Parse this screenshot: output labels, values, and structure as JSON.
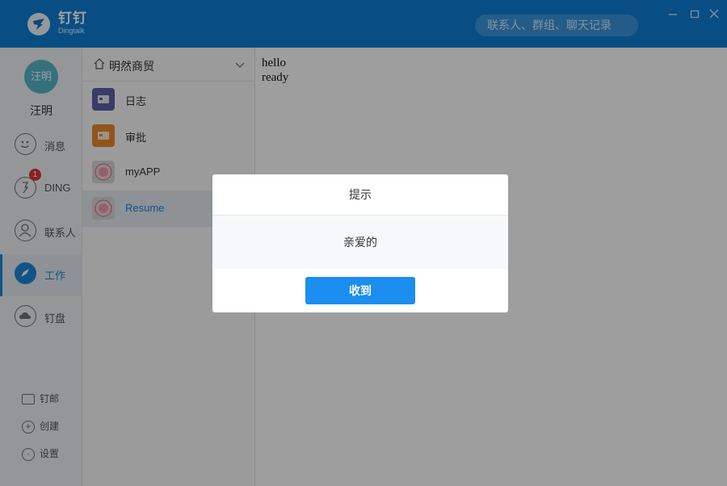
{
  "header": {
    "brand_cn": "钉钉",
    "brand_en": "Dingtalk",
    "search_placeholder": "联系人、群组、聊天记录",
    "colors": {
      "bar": "#0d7ed6",
      "accent": "#1b87dc"
    }
  },
  "user": {
    "avatar_text": "汪明",
    "name": "汪明"
  },
  "nav": {
    "items": [
      {
        "label": "消息",
        "icon": "smile-icon"
      },
      {
        "label": "DING",
        "icon": "ding-icon",
        "badge": "1"
      },
      {
        "label": "联系人",
        "icon": "contacts-icon"
      },
      {
        "label": "工作",
        "icon": "compass-icon",
        "active": true
      },
      {
        "label": "钉盘",
        "icon": "cloud-drive-icon"
      }
    ],
    "bottom": [
      {
        "label": "钉邮",
        "icon": "mail-icon"
      },
      {
        "label": "创建",
        "icon": "plus-icon"
      },
      {
        "label": "设置",
        "icon": "gear-icon"
      }
    ]
  },
  "workspace": {
    "org_name": "明然商贸",
    "apps": [
      {
        "label": "日志",
        "icon": "log-icon"
      },
      {
        "label": "审批",
        "icon": "approval-icon"
      },
      {
        "label": "myAPP",
        "icon": "app-icon"
      },
      {
        "label": "Resume",
        "icon": "app-icon",
        "selected": true
      }
    ]
  },
  "content": {
    "lines": [
      "hello",
      "ready"
    ]
  },
  "dialog": {
    "title": "提示",
    "message": "亲爱的",
    "button": "收到"
  }
}
